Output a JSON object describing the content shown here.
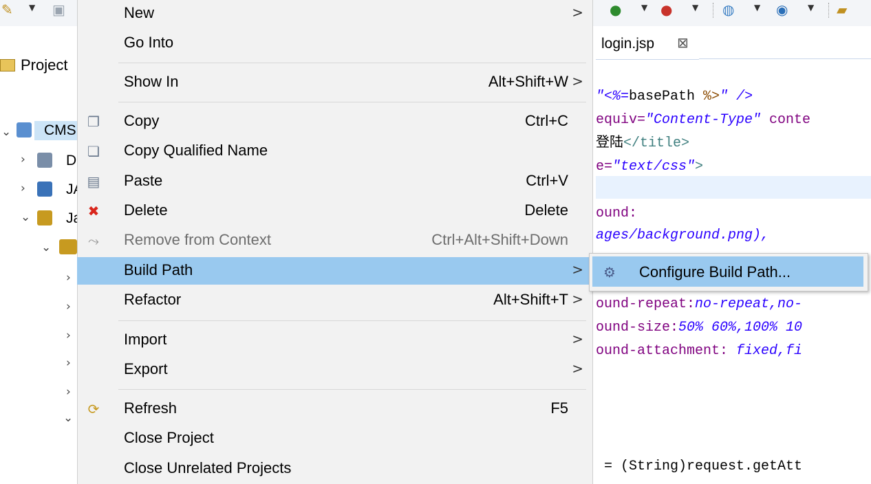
{
  "toolbar": {
    "icons": [
      "new-file-icon",
      "save-icon",
      "run-icon",
      "debug-icon",
      "globe-icon",
      "server-icon",
      "open-folder-icon"
    ]
  },
  "explorer": {
    "tab_label": "Project",
    "tree": [
      {
        "label": "CMS",
        "icon": "java-project-icon"
      },
      {
        "label": "D",
        "icon": "deployment-descriptor-icon"
      },
      {
        "label": "JA",
        "icon": "jax-ws-icon"
      },
      {
        "label": "Ja",
        "icon": "java-resources-icon"
      }
    ]
  },
  "editor": {
    "tab_label": "login.jsp",
    "tab_close": "⊠",
    "code_lines": [
      {
        "segments": [
          {
            "t": "\"<%=",
            "c": "#2a00ff",
            "i": true
          },
          {
            "t": "basePath ",
            "c": "#000000"
          },
          {
            "t": "%>",
            "c": "#8a4a00"
          },
          {
            "t": "\" />",
            "c": "#2a00ff",
            "i": true
          }
        ]
      },
      {
        "segments": [
          {
            "t": "equiv=",
            "c": "#7f007f"
          },
          {
            "t": "\"Content-Type\"",
            "c": "#2a00ff",
            "i": true
          },
          {
            "t": " conte",
            "c": "#7f007f"
          }
        ]
      },
      {
        "segments": [
          {
            "t": "登陆",
            "c": "#000000"
          },
          {
            "t": "</title>",
            "c": "#3f7f7f"
          }
        ]
      },
      {
        "segments": [
          {
            "t": "e=",
            "c": "#7f007f"
          },
          {
            "t": "\"text/css\"",
            "c": "#2a00ff",
            "i": true
          },
          {
            "t": ">",
            "c": "#3f7f7f"
          }
        ]
      },
      {
        "segments": [
          {
            "t": "",
            "c": "#000000"
          }
        ]
      },
      {
        "segments": [
          {
            "t": "ound:",
            "c": "#7f007f"
          }
        ]
      },
      {
        "segments": [
          {
            "t": "ages/background.png),",
            "c": "#2a00ff",
            "i": true
          }
        ]
      },
      {
        "segments": [
          {
            "t": "",
            "c": "#000000"
          }
        ]
      },
      {
        "segments": [
          {
            "t": "",
            "c": "#000000"
          }
        ]
      },
      {
        "segments": [
          {
            "t": "ound-repeat:",
            "c": "#7f007f"
          },
          {
            "t": "no-repeat,no-",
            "c": "#2a00ff",
            "i": true
          }
        ]
      },
      {
        "segments": [
          {
            "t": "ound-size:",
            "c": "#7f007f"
          },
          {
            "t": "50% 60%,100% 10",
            "c": "#2a00ff",
            "i": true
          }
        ]
      },
      {
        "segments": [
          {
            "t": "ound-attachment: ",
            "c": "#7f007f"
          },
          {
            "t": "fixed,fi",
            "c": "#2a00ff",
            "i": true
          }
        ]
      },
      {
        "segments": [
          {
            "t": "",
            "c": "#000000"
          }
        ]
      },
      {
        "segments": [
          {
            "t": "",
            "c": "#000000"
          }
        ]
      },
      {
        "segments": [
          {
            "t": "",
            "c": "#000000"
          }
        ]
      },
      {
        "segments": [
          {
            "t": " = (String)request.getAtt",
            "c": "#000000"
          }
        ]
      }
    ]
  },
  "context_menu": {
    "items": [
      {
        "label": "New",
        "submenu": true
      },
      {
        "label": "Go Into"
      },
      {
        "label": "Show In",
        "shortcut": "Alt+Shift+W",
        "submenu": true
      },
      {
        "label": "Copy",
        "shortcut": "Ctrl+C",
        "icon": "copy-icon"
      },
      {
        "label": "Copy Qualified Name",
        "icon": "copy-qualified-name-icon"
      },
      {
        "label": "Paste",
        "shortcut": "Ctrl+V",
        "icon": "paste-icon"
      },
      {
        "label": "Delete",
        "shortcut": "Delete",
        "icon": "delete-icon"
      },
      {
        "label": "Remove from Context",
        "shortcut": "Ctrl+Alt+Shift+Down",
        "disabled": true,
        "icon": "remove-from-context-icon"
      },
      {
        "label": "Build Path",
        "submenu": true,
        "selected": true
      },
      {
        "label": "Refactor",
        "shortcut": "Alt+Shift+T",
        "submenu": true
      },
      {
        "label": "Import",
        "submenu": true
      },
      {
        "label": "Export",
        "submenu": true
      },
      {
        "label": "Refresh",
        "shortcut": "F5",
        "icon": "refresh-icon"
      },
      {
        "label": "Close Project"
      },
      {
        "label": "Close Unrelated Projects"
      }
    ],
    "submenu_arrow": ">"
  },
  "build_path_submenu": {
    "items": [
      {
        "label": "Configure Build Path...",
        "icon": "configure-build-path-icon",
        "selected": true
      }
    ]
  },
  "colors": {
    "menu_bg": "#f2f2f2",
    "selection": "#99c9ef",
    "disabled_text": "#6d6d6d",
    "delete_icon": "#d9261c"
  }
}
